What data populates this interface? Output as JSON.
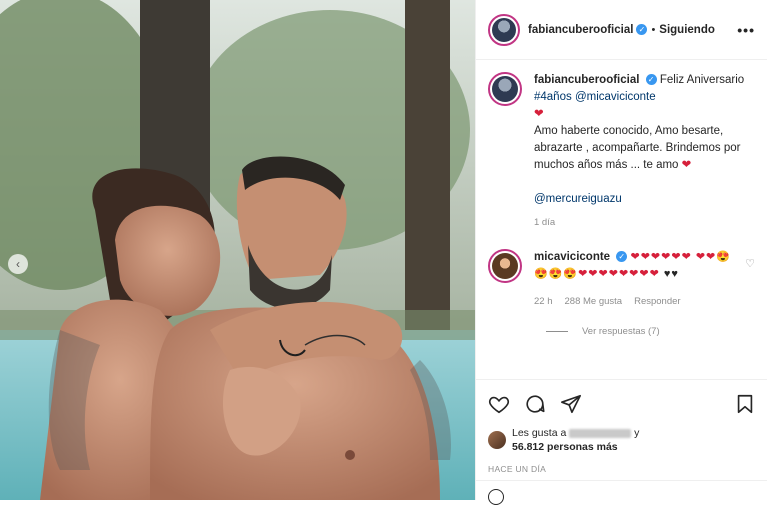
{
  "post": {
    "username": "fabiancuberooficial",
    "follow_status": "Siguiendo",
    "more_label": "•••",
    "caption": {
      "username": "fabiancuberooficial",
      "text_1": "Feliz Aniversario",
      "hashtag": "#4años",
      "mention": "@micaviciconte",
      "text_2": "Amo haberte conocido, Amo besarte, abrazarte , acompañarte. Brindemos por muchos años más ... te amo",
      "mention_2": "@mercureiguazu",
      "age": "1 día"
    },
    "comment": {
      "username": "micaviciconte",
      "age": "22 h",
      "likes": "288 Me gusta",
      "reply_label": "Responder",
      "view_replies": "Ver respuestas (7)"
    },
    "likes": {
      "prefix": "Les gusta a",
      "suffix": "y",
      "count_text": "56.812 personas más"
    },
    "timestamp": "HACE UN DÍA"
  },
  "colors": {
    "link": "#00376b",
    "verified": "#3897f0",
    "heart": "#d6203b",
    "muted": "#8e8e8e"
  },
  "icons": [
    "heart-icon",
    "comment-icon",
    "share-icon",
    "bookmark-icon",
    "chevron-left-icon",
    "more-icon"
  ]
}
